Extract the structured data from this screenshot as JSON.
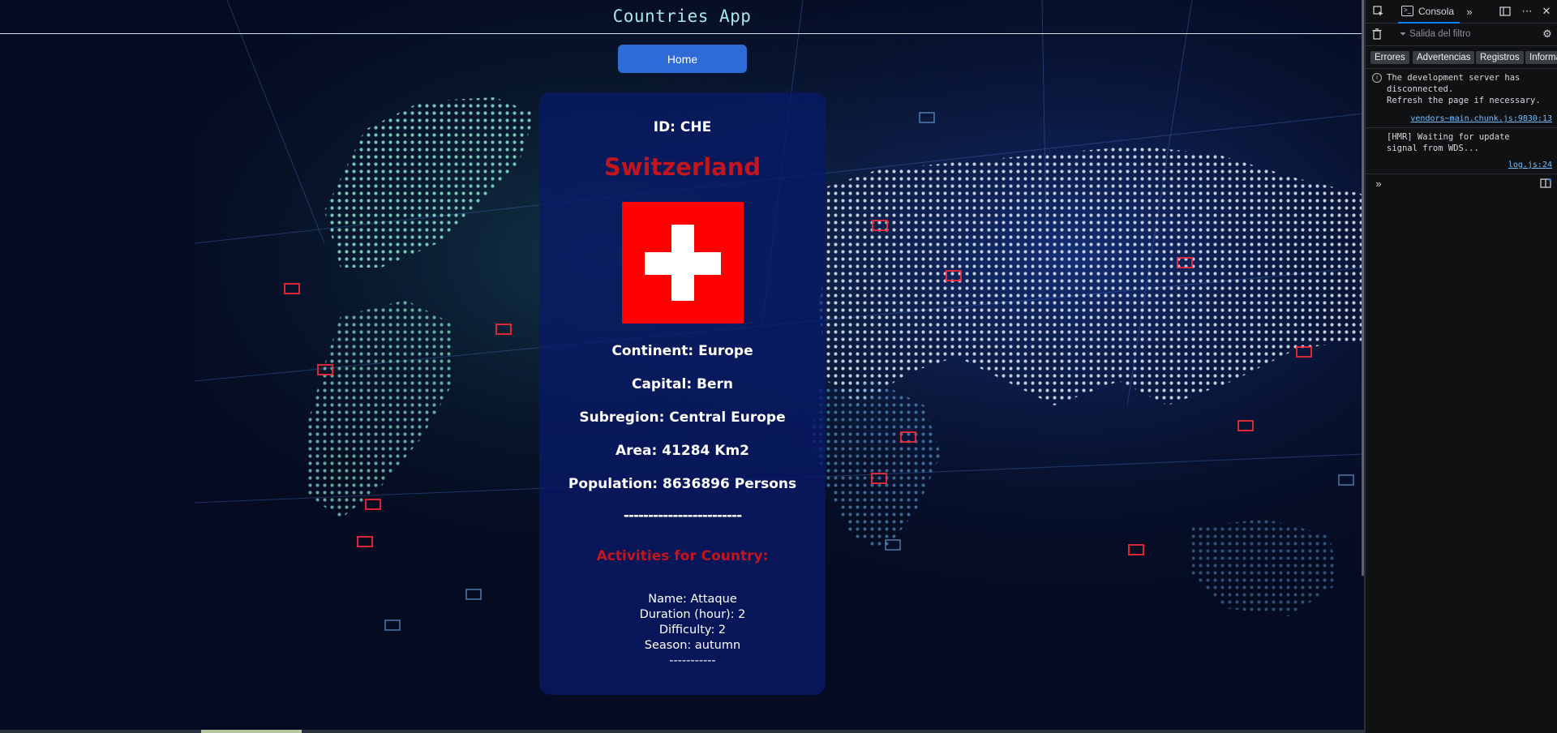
{
  "app": {
    "title": "Countries App",
    "home_button": "Home"
  },
  "country": {
    "id_label": "ID: CHE",
    "name": "Switzerland",
    "flag": {
      "background": "#ff0000",
      "cross": "#ffffff"
    },
    "continent": "Continent: Europe",
    "capital": "Capital: Bern",
    "subregion": "Subregion: Central Europe",
    "area": "Area: 41284 Km2",
    "population": "Population: 8636896 Persons",
    "divider": "------------------------",
    "activities_title": "Activities for Country:",
    "activities": [
      {
        "name": "Name: Attaque",
        "duration": "Duration (hour): 2",
        "difficulty": "Difficulty: 2",
        "season": "Season: autumn",
        "separator": "-----------"
      }
    ]
  },
  "colors": {
    "accent": "#2e6bd6",
    "country_name": "#c3151c",
    "card_bg": "#081a68",
    "title_text": "#a9e6e6"
  },
  "devtools": {
    "tab_label": "Consola",
    "filter_placeholder": "Salida del filtro",
    "levels": [
      "Errores",
      "Advertencias",
      "Registros",
      "Informa"
    ],
    "messages": [
      {
        "text": "The development server has\ndisconnected.\nRefresh the page if necessary.",
        "source": "vendors~main.chunk.js:9830:13",
        "icon": "info-icon"
      },
      {
        "text": "[HMR] Waiting for update\nsignal from WDS...",
        "source": "log.js:24",
        "icon": ""
      }
    ],
    "icons": {
      "picker": "element-picker-icon",
      "console": "console-icon",
      "more_tabs": "chevron-double-right-icon",
      "dock": "dock-side-icon",
      "menu": "ellipsis-icon",
      "close": "close-icon",
      "trash": "trash-icon",
      "filter": "filter-icon",
      "settings": "gear-icon",
      "prompt": "prompt-icon",
      "split": "split-console-icon"
    }
  }
}
